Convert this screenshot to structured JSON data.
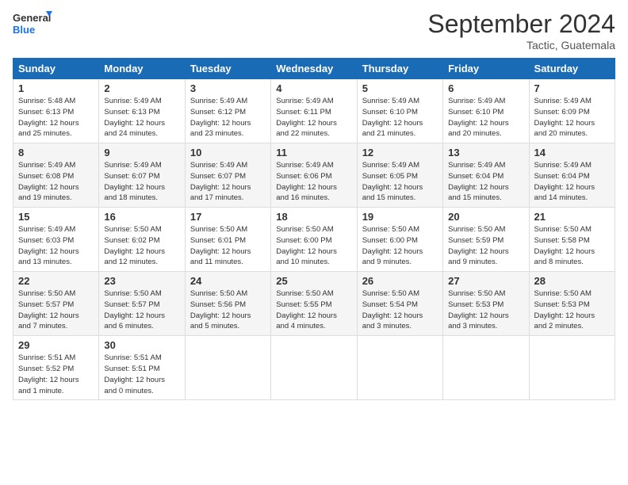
{
  "logo": {
    "line1": "General",
    "line2": "Blue"
  },
  "title": "September 2024",
  "location": "Tactic, Guatemala",
  "days_header": [
    "Sunday",
    "Monday",
    "Tuesday",
    "Wednesday",
    "Thursday",
    "Friday",
    "Saturday"
  ],
  "weeks": [
    [
      {
        "day": "1",
        "info": "Sunrise: 5:48 AM\nSunset: 6:13 PM\nDaylight: 12 hours\nand 25 minutes."
      },
      {
        "day": "2",
        "info": "Sunrise: 5:49 AM\nSunset: 6:13 PM\nDaylight: 12 hours\nand 24 minutes."
      },
      {
        "day": "3",
        "info": "Sunrise: 5:49 AM\nSunset: 6:12 PM\nDaylight: 12 hours\nand 23 minutes."
      },
      {
        "day": "4",
        "info": "Sunrise: 5:49 AM\nSunset: 6:11 PM\nDaylight: 12 hours\nand 22 minutes."
      },
      {
        "day": "5",
        "info": "Sunrise: 5:49 AM\nSunset: 6:10 PM\nDaylight: 12 hours\nand 21 minutes."
      },
      {
        "day": "6",
        "info": "Sunrise: 5:49 AM\nSunset: 6:10 PM\nDaylight: 12 hours\nand 20 minutes."
      },
      {
        "day": "7",
        "info": "Sunrise: 5:49 AM\nSunset: 6:09 PM\nDaylight: 12 hours\nand 20 minutes."
      }
    ],
    [
      {
        "day": "8",
        "info": "Sunrise: 5:49 AM\nSunset: 6:08 PM\nDaylight: 12 hours\nand 19 minutes."
      },
      {
        "day": "9",
        "info": "Sunrise: 5:49 AM\nSunset: 6:07 PM\nDaylight: 12 hours\nand 18 minutes."
      },
      {
        "day": "10",
        "info": "Sunrise: 5:49 AM\nSunset: 6:07 PM\nDaylight: 12 hours\nand 17 minutes."
      },
      {
        "day": "11",
        "info": "Sunrise: 5:49 AM\nSunset: 6:06 PM\nDaylight: 12 hours\nand 16 minutes."
      },
      {
        "day": "12",
        "info": "Sunrise: 5:49 AM\nSunset: 6:05 PM\nDaylight: 12 hours\nand 15 minutes."
      },
      {
        "day": "13",
        "info": "Sunrise: 5:49 AM\nSunset: 6:04 PM\nDaylight: 12 hours\nand 15 minutes."
      },
      {
        "day": "14",
        "info": "Sunrise: 5:49 AM\nSunset: 6:04 PM\nDaylight: 12 hours\nand 14 minutes."
      }
    ],
    [
      {
        "day": "15",
        "info": "Sunrise: 5:49 AM\nSunset: 6:03 PM\nDaylight: 12 hours\nand 13 minutes."
      },
      {
        "day": "16",
        "info": "Sunrise: 5:50 AM\nSunset: 6:02 PM\nDaylight: 12 hours\nand 12 minutes."
      },
      {
        "day": "17",
        "info": "Sunrise: 5:50 AM\nSunset: 6:01 PM\nDaylight: 12 hours\nand 11 minutes."
      },
      {
        "day": "18",
        "info": "Sunrise: 5:50 AM\nSunset: 6:00 PM\nDaylight: 12 hours\nand 10 minutes."
      },
      {
        "day": "19",
        "info": "Sunrise: 5:50 AM\nSunset: 6:00 PM\nDaylight: 12 hours\nand 9 minutes."
      },
      {
        "day": "20",
        "info": "Sunrise: 5:50 AM\nSunset: 5:59 PM\nDaylight: 12 hours\nand 9 minutes."
      },
      {
        "day": "21",
        "info": "Sunrise: 5:50 AM\nSunset: 5:58 PM\nDaylight: 12 hours\nand 8 minutes."
      }
    ],
    [
      {
        "day": "22",
        "info": "Sunrise: 5:50 AM\nSunset: 5:57 PM\nDaylight: 12 hours\nand 7 minutes."
      },
      {
        "day": "23",
        "info": "Sunrise: 5:50 AM\nSunset: 5:57 PM\nDaylight: 12 hours\nand 6 minutes."
      },
      {
        "day": "24",
        "info": "Sunrise: 5:50 AM\nSunset: 5:56 PM\nDaylight: 12 hours\nand 5 minutes."
      },
      {
        "day": "25",
        "info": "Sunrise: 5:50 AM\nSunset: 5:55 PM\nDaylight: 12 hours\nand 4 minutes."
      },
      {
        "day": "26",
        "info": "Sunrise: 5:50 AM\nSunset: 5:54 PM\nDaylight: 12 hours\nand 3 minutes."
      },
      {
        "day": "27",
        "info": "Sunrise: 5:50 AM\nSunset: 5:53 PM\nDaylight: 12 hours\nand 3 minutes."
      },
      {
        "day": "28",
        "info": "Sunrise: 5:50 AM\nSunset: 5:53 PM\nDaylight: 12 hours\nand 2 minutes."
      }
    ],
    [
      {
        "day": "29",
        "info": "Sunrise: 5:51 AM\nSunset: 5:52 PM\nDaylight: 12 hours\nand 1 minute."
      },
      {
        "day": "30",
        "info": "Sunrise: 5:51 AM\nSunset: 5:51 PM\nDaylight: 12 hours\nand 0 minutes."
      },
      {
        "day": "",
        "info": ""
      },
      {
        "day": "",
        "info": ""
      },
      {
        "day": "",
        "info": ""
      },
      {
        "day": "",
        "info": ""
      },
      {
        "day": "",
        "info": ""
      }
    ]
  ]
}
